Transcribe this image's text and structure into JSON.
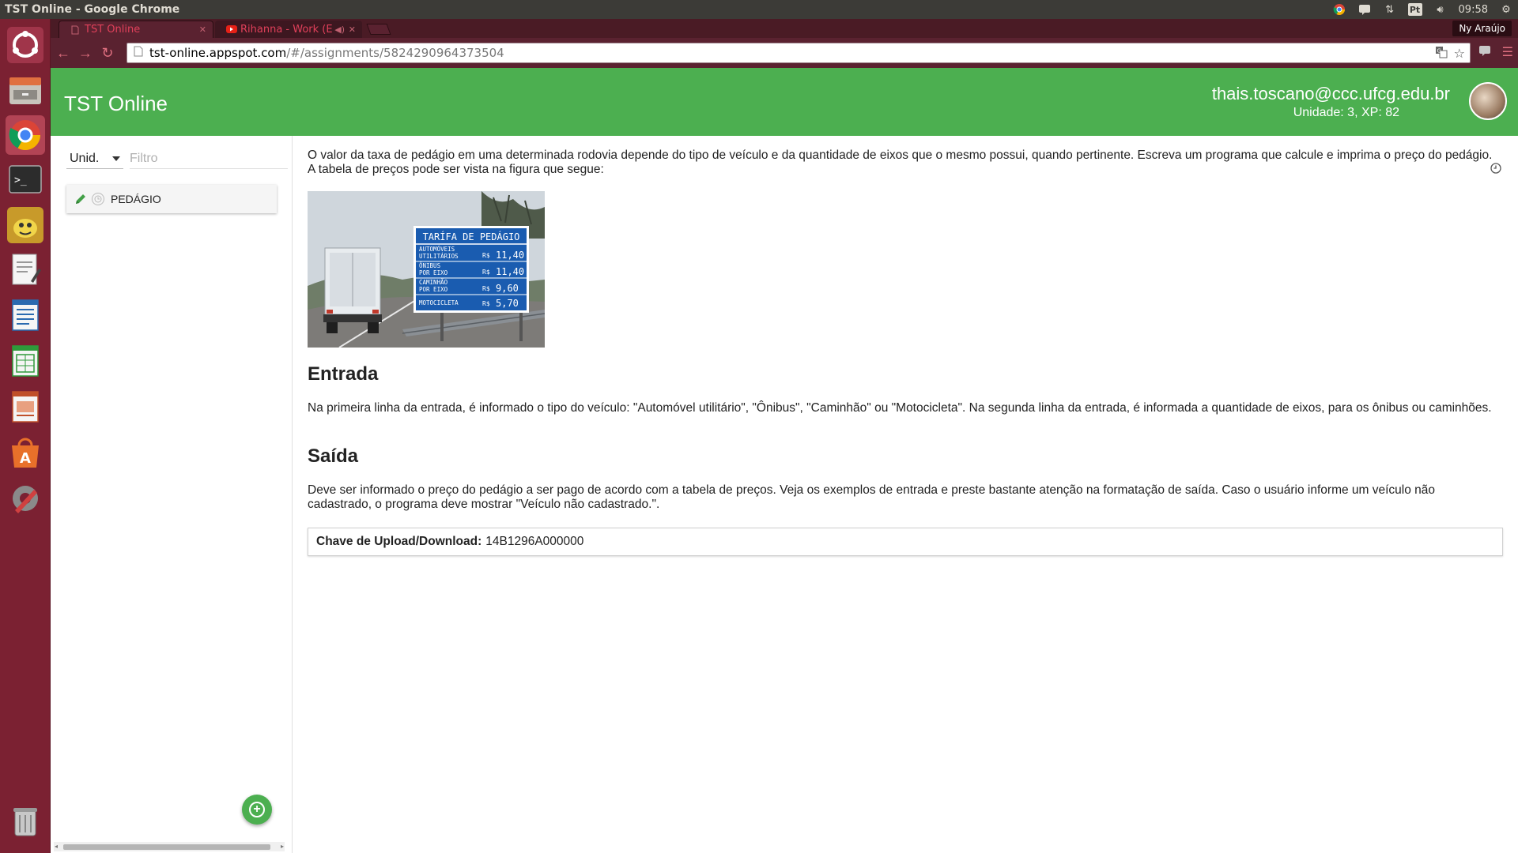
{
  "os_panel": {
    "window_title": "TST Online - Google Chrome",
    "keyboard_layout": "Pt",
    "clock": "09:58"
  },
  "launcher": {
    "apps": [
      "ubuntu-dash-icon",
      "files-icon",
      "chrome-icon",
      "terminal-icon",
      "pidgin-icon",
      "text-editor-icon",
      "writer-icon",
      "calc-icon",
      "impress-icon",
      "software-center-icon",
      "settings-icon",
      "trash-icon"
    ]
  },
  "browser": {
    "tabs": [
      {
        "label": "TST Online",
        "active": true
      },
      {
        "label": "Rihanna - Work (E",
        "active": false
      }
    ],
    "profile_name": "Ny Araújo",
    "url_host": "tst-online.appspot.com",
    "url_path": "/#/assignments/5824290964373504"
  },
  "header": {
    "title": "TST Online",
    "user_email": "thais.toscano@ccc.ufcg.edu.br",
    "user_stats": "Unidade: 3, XP: 82"
  },
  "sidebar": {
    "unit_select_value": "Unid.",
    "filter_placeholder": "Filtro",
    "assignments": [
      {
        "label": "PEDÁGIO"
      }
    ]
  },
  "assignment": {
    "intro": "O valor da taxa de pedágio em uma determinada rodovia depende do tipo de veículo e da quantidade de eixos que o mesmo possui, quando pertinente. Escreva um programa que calcule e imprima o preço do pedágio. A tabela de preços pode ser vista na figura que segue:",
    "image_sign": {
      "title": "TARÍFA DE PEDÁGIO",
      "rows": [
        {
          "vehicle_line1": "AUTOMÓVEIS",
          "vehicle_line2": "UTILITÁRIOS",
          "currency": "R$",
          "price": "11,40"
        },
        {
          "vehicle_line1": "ÔNIBUS",
          "vehicle_line2": "POR EIXO",
          "currency": "R$",
          "price": "11,40"
        },
        {
          "vehicle_line1": "CAMINHÃO",
          "vehicle_line2": "POR EIXO",
          "currency": "R$",
          "price": "9,60"
        },
        {
          "vehicle_line1": "MOTOCICLETA",
          "vehicle_line2": "",
          "currency": "R$",
          "price": "5,70"
        }
      ]
    },
    "entrada_title": "Entrada",
    "entrada_text": "Na primeira linha da entrada, é informado o tipo do veículo: \"Automóvel utilitário\", \"Ônibus\", \"Caminhão\" ou \"Motocicleta\". Na segunda linha da entrada, é informada a quantidade de eixos, para os ônibus ou caminhões.",
    "saida_title": "Saída",
    "saida_text": "Deve ser informado o preço do pedágio a ser pago de acordo com a tabela de preços. Veja os exemplos de entrada e preste bastante atenção na formatação de saída. Caso o usuário informe um veículo não cadastrado, o programa deve mostrar \"Veículo não cadastrado.\".",
    "key_label": "Chave de Upload/Download:",
    "key_value": "14B1296A000000"
  },
  "colors": {
    "header_green": "#4caf50",
    "launcher_bg": "#7b2132",
    "chrome_frame": "#5a2230",
    "sign_blue": "#1a5cb0"
  }
}
